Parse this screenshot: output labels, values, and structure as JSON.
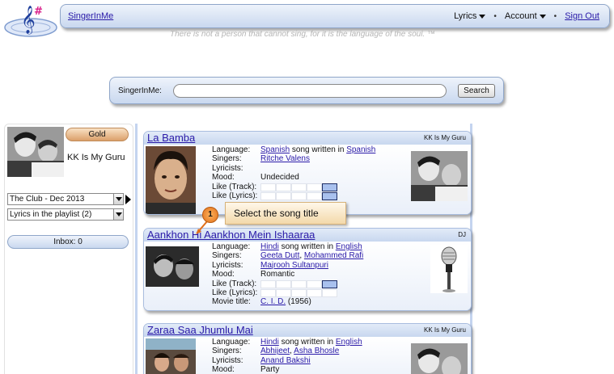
{
  "header": {
    "brand": "SingerInMe",
    "nav": [
      "Lyrics",
      "Account"
    ],
    "sign_out": "Sign Out",
    "tagline": "There is not a person that cannot sing, for it is the language of the soul. ™"
  },
  "search": {
    "label": "SingerInMe:",
    "value": "",
    "button": "Search"
  },
  "sidebar": {
    "badge": "Gold",
    "profile_name": "KK Is My Guru",
    "playlist_select": "The Club - Dec 2013",
    "lyrics_select": "Lyrics in the playlist (2)",
    "inbox": "Inbox: 0"
  },
  "labels": {
    "language": "Language:",
    "singers": "Singers:",
    "lyricists": "Lyricists:",
    "mood": "Mood:",
    "like_track": "Like (Track):",
    "like_lyrics": "Like (Lyrics):",
    "movie_title": "Movie title:",
    "song_written_in": "song written in"
  },
  "songs": [
    {
      "title": "La Bamba",
      "owner": "KK Is My Guru",
      "language": "Spanish",
      "written_in": "Spanish",
      "singers": [
        "Ritche Valens"
      ],
      "lyricists": [],
      "mood": "Undecided",
      "like_track": 4,
      "like_lyrics": 4
    },
    {
      "title": "Aankhon Hi Aankhon Mein Ishaaraa",
      "owner": "DJ",
      "language": "Hindi",
      "written_in": "English",
      "singers": [
        "Geeta Dutt",
        "Mohammed Rafi"
      ],
      "lyricists": [
        "Majrooh Sultanpuri"
      ],
      "mood": "Romantic",
      "like_track": 4,
      "like_lyrics": 0,
      "movie_title": "C. I. D.",
      "movie_year": "(1956)"
    },
    {
      "title": "Zaraa Saa Jhumlu Mai",
      "owner": "KK Is My Guru",
      "language": "Hindi",
      "written_in": "English",
      "singers": [
        "Abhijeet",
        "Asha Bhosle"
      ],
      "lyricists": [
        "Anand Bakshi"
      ],
      "mood": "Party"
    }
  ],
  "callout": {
    "step": "1",
    "text": "Select the song title"
  }
}
